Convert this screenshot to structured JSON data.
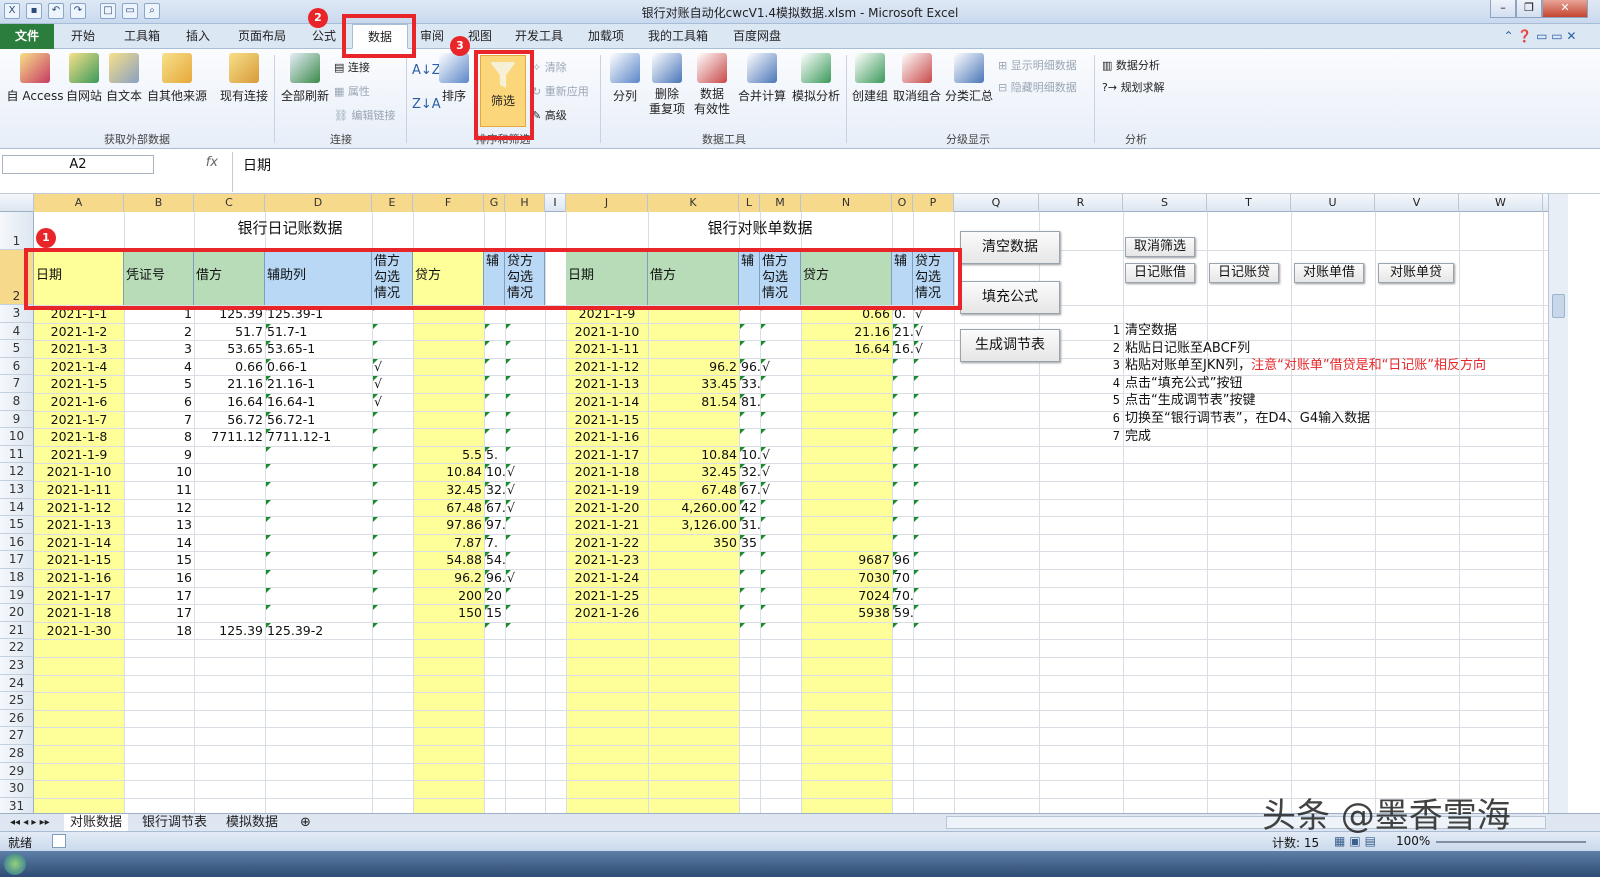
{
  "window": {
    "title": "银行对账自动化cwcV1.4模拟数据.xlsm - Microsoft Excel"
  },
  "tabs": [
    "文件",
    "开始",
    "工具箱",
    "插入",
    "页面布局",
    "公式",
    "数据",
    "审阅",
    "视图",
    "开发工具",
    "加载项",
    "我的工具箱",
    "百度网盘"
  ],
  "ribbon": {
    "ext_group": {
      "label": "获取外部数据",
      "buttons": [
        "自 Access",
        "自网站",
        "自文本",
        "自其他来源",
        "现有连接"
      ]
    },
    "conn_group": {
      "label": "连接",
      "refresh": "全部刷新",
      "items": [
        "连接",
        "属性",
        "编辑链接"
      ]
    },
    "sort_group": {
      "label": "排序和筛选",
      "sort": "排序",
      "filter": "筛选",
      "items": [
        "清除",
        "重新应用",
        "高级"
      ]
    },
    "tools_group": {
      "label": "数据工具",
      "buttons": [
        "分列",
        "删除\n重复项",
        "数据\n有效性",
        "合并计算",
        "模拟分析"
      ]
    },
    "outline_group": {
      "label": "分级显示",
      "buttons": [
        "创建组",
        "取消组合",
        "分类汇总"
      ],
      "items": [
        "显示明细数据",
        "隐藏明细数据"
      ]
    },
    "analysis_group": {
      "label": "分析",
      "items": [
        "数据分析",
        "规划求解"
      ]
    }
  },
  "formula_bar": {
    "name_box": "A2",
    "fx": "fx",
    "value": "日期"
  },
  "columns": [
    "A",
    "B",
    "C",
    "D",
    "E",
    "F",
    "G",
    "H",
    "I",
    "J",
    "K",
    "L",
    "M",
    "N",
    "O",
    "P",
    "Q",
    "R",
    "S",
    "T",
    "U",
    "V",
    "W"
  ],
  "titles": {
    "journal": "银行日记账数据",
    "statement": "银行对账单数据"
  },
  "headers": {
    "A": "日期",
    "B": "凭证号",
    "C": "借方",
    "D": "辅助列",
    "E": "借方\n勾选\n情况",
    "F": "贷方",
    "G": "辅",
    "H": "贷方\n勾选\n情况",
    "J": "日期",
    "K": "借方",
    "L": "辅",
    "M": "借方\n勾选\n情况",
    "N": "贷方",
    "O": "辅",
    "P": "贷方\n勾选\n情况"
  },
  "rows": [
    {
      "A": "2021-1-1",
      "B": "1",
      "C": "125.39",
      "D": "125.39-1",
      "J": "2021-1-9",
      "N": "0.66",
      "O": "0.",
      "P": "√"
    },
    {
      "A": "2021-1-2",
      "B": "2",
      "C": "51.7",
      "D": "51.7-1",
      "J": "2021-1-10",
      "N": "21.16",
      "O": "21.",
      "P": "√"
    },
    {
      "A": "2021-1-3",
      "B": "3",
      "C": "53.65",
      "D": "53.65-1",
      "J": "2021-1-11",
      "N": "16.64",
      "O": "16.",
      "P": "√"
    },
    {
      "A": "2021-1-4",
      "B": "4",
      "C": "0.66",
      "D": "0.66-1",
      "E": "√",
      "J": "2021-1-12",
      "K": "96.2",
      "L": "96.",
      "M": "√"
    },
    {
      "A": "2021-1-5",
      "B": "5",
      "C": "21.16",
      "D": "21.16-1",
      "E": "√",
      "J": "2021-1-13",
      "K": "33.45",
      "L": "33."
    },
    {
      "A": "2021-1-6",
      "B": "6",
      "C": "16.64",
      "D": "16.64-1",
      "E": "√",
      "J": "2021-1-14",
      "K": "81.54",
      "L": "81."
    },
    {
      "A": "2021-1-7",
      "B": "7",
      "C": "56.72",
      "D": "56.72-1",
      "J": "2021-1-15"
    },
    {
      "A": "2021-1-8",
      "B": "8",
      "C": "7711.12",
      "D": "7711.12-1",
      "J": "2021-1-16"
    },
    {
      "A": "2021-1-9",
      "B": "9",
      "F": "5.5",
      "G": "5.",
      "J": "2021-1-17",
      "K": "10.84",
      "L": "10.",
      "M": "√"
    },
    {
      "A": "2021-1-10",
      "B": "10",
      "F": "10.84",
      "G": "10.",
      "H": "√",
      "J": "2021-1-18",
      "K": "32.45",
      "L": "32.",
      "M": "√"
    },
    {
      "A": "2021-1-11",
      "B": "11",
      "F": "32.45",
      "G": "32.",
      "H": "√",
      "J": "2021-1-19",
      "K": "67.48",
      "L": "67.",
      "M": "√"
    },
    {
      "A": "2021-1-12",
      "B": "12",
      "F": "67.48",
      "G": "67.",
      "H": "√",
      "J": "2021-1-20",
      "K": "4,260.00",
      "L": "42"
    },
    {
      "A": "2021-1-13",
      "B": "13",
      "F": "97.86",
      "G": "97.",
      "J": "2021-1-21",
      "K": "3,126.00",
      "L": "31."
    },
    {
      "A": "2021-1-14",
      "B": "14",
      "F": "7.87",
      "G": "7.",
      "J": "2021-1-22",
      "K": "350",
      "L": "35"
    },
    {
      "A": "2021-1-15",
      "B": "15",
      "F": "54.88",
      "G": "54.",
      "J": "2021-1-23",
      "N": "9687",
      "O": "96"
    },
    {
      "A": "2021-1-16",
      "B": "16",
      "F": "96.2",
      "G": "96.",
      "H": "√",
      "J": "2021-1-24",
      "N": "7030",
      "O": "70"
    },
    {
      "A": "2021-1-17",
      "B": "17",
      "F": "200",
      "G": "20",
      "J": "2021-1-25",
      "N": "7024",
      "O": "70."
    },
    {
      "A": "2021-1-18",
      "B": "17",
      "F": "150",
      "G": "15",
      "J": "2021-1-26",
      "N": "5938",
      "O": "59."
    },
    {
      "A": "2021-1-30",
      "B": "18",
      "C": "125.39",
      "D": "125.39-2"
    }
  ],
  "row_numbers": [
    "1",
    "2",
    "3",
    "4",
    "5",
    "6",
    "7",
    "8",
    "9",
    "10",
    "11",
    "12",
    "13",
    "14",
    "15",
    "16",
    "17",
    "18",
    "19",
    "20",
    "21",
    "22",
    "23",
    "24",
    "25",
    "26",
    "27",
    "28",
    "29",
    "30",
    "31"
  ],
  "buttons": {
    "clear": "清空数据",
    "fill": "填充公式",
    "generate": "生成调节表",
    "cancel_filter": "取消筛选",
    "journal_debit": "日记账借",
    "journal_credit": "日记账贷",
    "stmt_debit": "对账单借",
    "stmt_credit": "对账单贷"
  },
  "instructions": [
    {
      "n": "1",
      "text": "清空数据"
    },
    {
      "n": "2",
      "text": "粘贴日记账至ABCF列"
    },
    {
      "n": "3",
      "text": "粘贴对账单至JKN列，",
      "warn": "注意“对账单”借贷是和“日记账”相反方向"
    },
    {
      "n": "4",
      "text": "点击“填充公式”按钮"
    },
    {
      "n": "5",
      "text": "点击“生成调节表”按键"
    },
    {
      "n": "6",
      "text": "切换至“银行调节表”，在D4、G4输入数据"
    },
    {
      "n": "7",
      "text": "完成"
    }
  ],
  "badges": [
    "1",
    "2",
    "3"
  ],
  "sheets": [
    "对账数据",
    "银行调节表",
    "模拟数据"
  ],
  "status": {
    "mode": "就绪",
    "count": "计数: 15",
    "zoom": "100%"
  },
  "watermark": "头条 @墨香雪海",
  "colors": {
    "yellow": "#ffff99",
    "green": "#b7dcb7",
    "blue": "#b9d8f5",
    "red": "#e8262a",
    "file_tab": "#2a7d3c"
  }
}
